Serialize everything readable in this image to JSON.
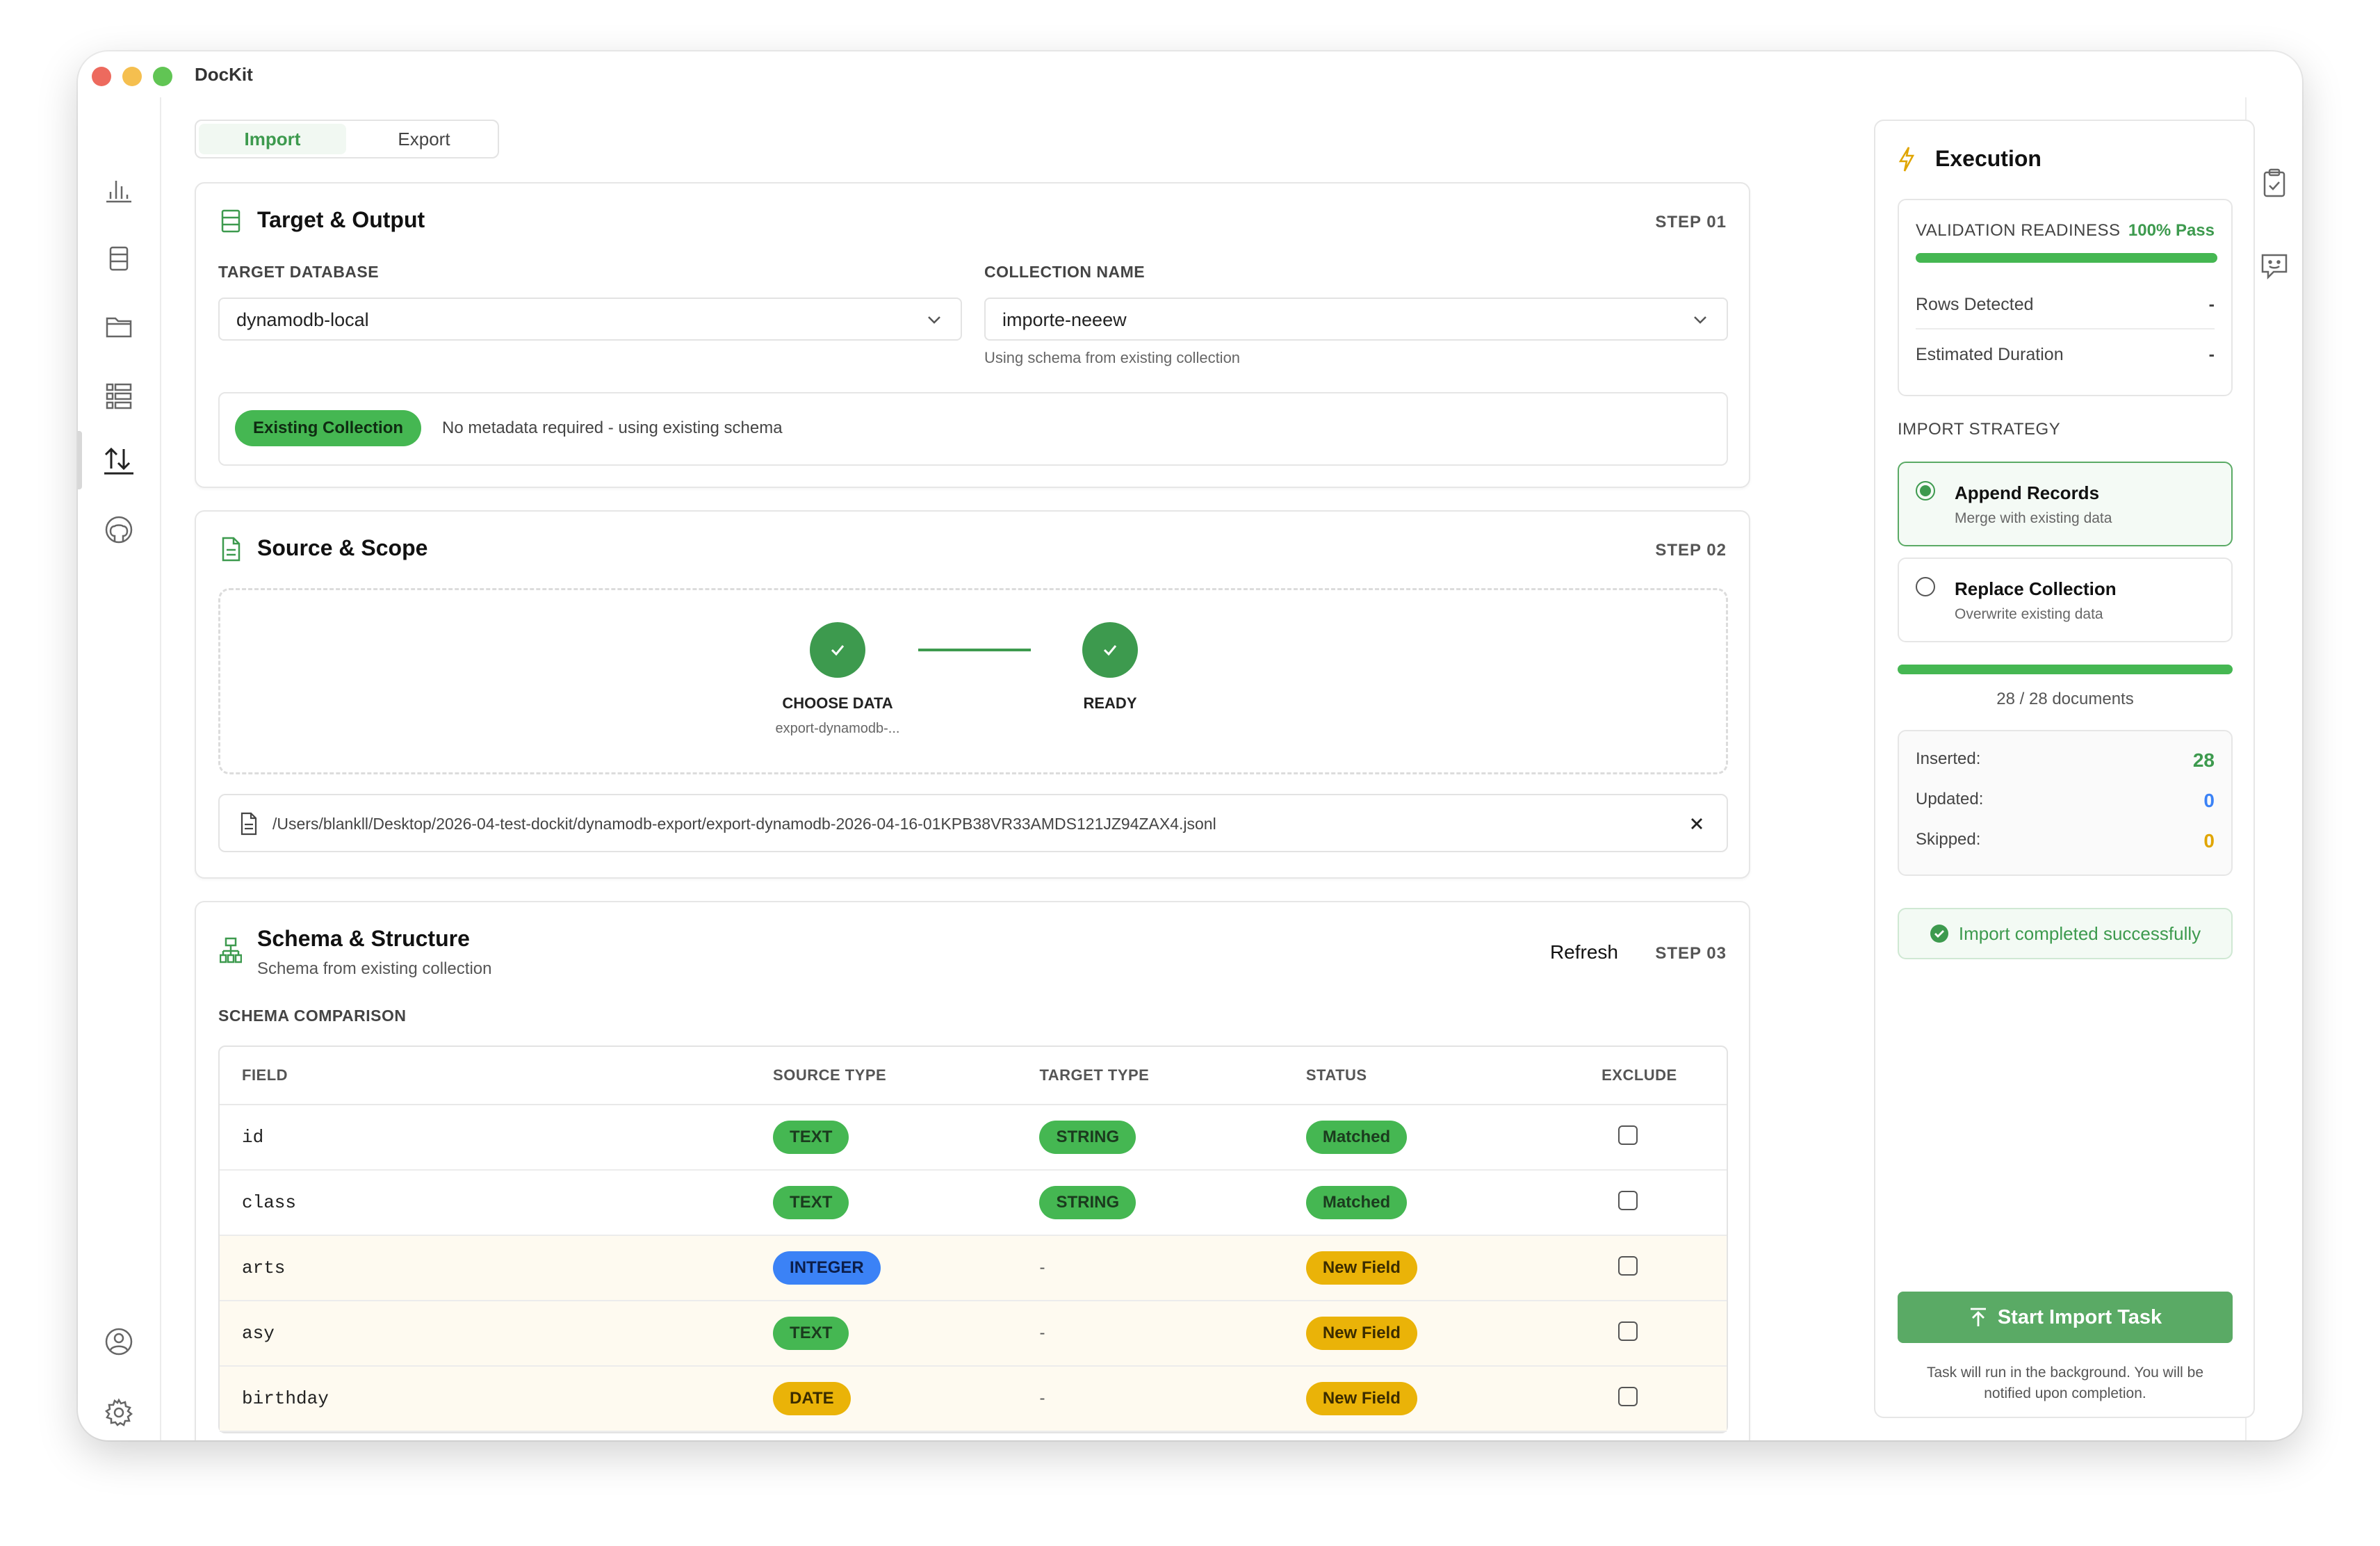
{
  "app": {
    "title": "DocKit"
  },
  "tabs": [
    {
      "label": "Import"
    },
    {
      "label": "Export"
    }
  ],
  "target": {
    "title": "Target & Output",
    "step": "STEP 01",
    "db_label": "TARGET DATABASE",
    "db_value": "dynamodb-local",
    "coll_label": "COLLECTION NAME",
    "coll_value": "importe-neeew",
    "coll_hint": "Using schema from existing collection",
    "badge": "Existing Collection",
    "badge_note": "No metadata required - using existing schema"
  },
  "source": {
    "title": "Source & Scope",
    "step": "STEP 02",
    "step1_label": "CHOOSE DATA",
    "step1_sub": "export-dynamodb-...",
    "step2_label": "READY",
    "file_path": "/Users/blankll/Desktop/2026-04-test-dockit/dynamodb-export/export-dynamodb-2026-04-16-01KPB38VR33AMDS121JZ94ZAX4.jsonl"
  },
  "schema": {
    "title": "Schema & Structure",
    "subtitle": "Schema from existing collection",
    "refresh": "Refresh",
    "step": "STEP 03",
    "comparison_label": "SCHEMA COMPARISON",
    "headers": [
      "FIELD",
      "SOURCE TYPE",
      "TARGET TYPE",
      "STATUS",
      "EXCLUDE"
    ],
    "rows": [
      {
        "field": "id",
        "source": "TEXT",
        "target": "STRING",
        "status": "Matched"
      },
      {
        "field": "class",
        "source": "TEXT",
        "target": "STRING",
        "status": "Matched"
      },
      {
        "field": "arts",
        "source": "INTEGER",
        "target": "-",
        "status": "New Field"
      },
      {
        "field": "asy",
        "source": "TEXT",
        "target": "-",
        "status": "New Field"
      },
      {
        "field": "birthday",
        "source": "DATE",
        "target": "-",
        "status": "New Field"
      }
    ]
  },
  "execution": {
    "title": "Execution",
    "readiness_label": "VALIDATION READINESS",
    "readiness_value": "100% Pass",
    "readiness_fraction": 1.0,
    "rows_label": "Rows Detected",
    "rows_value": "-",
    "duration_label": "Estimated Duration",
    "duration_value": "-",
    "strategy_label": "IMPORT STRATEGY",
    "strategy_options": [
      {
        "title": "Append Records",
        "sub": "Merge with existing data"
      },
      {
        "title": "Replace Collection",
        "sub": "Overwrite existing data"
      }
    ],
    "progress_fraction": 1.0,
    "progress_text": "28 / 28 documents",
    "inserted_label": "Inserted:",
    "inserted_value": "28",
    "updated_label": "Updated:",
    "updated_value": "0",
    "skipped_label": "Skipped:",
    "skipped_value": "0",
    "success_message": "Import completed successfully",
    "start_button": "Start Import Task",
    "footnote": "Task will run in the background. You will be notified upon completion."
  },
  "colors": {
    "accent": "#3d9a4e",
    "blue": "#3b82f6",
    "orange": "#e0a500"
  }
}
